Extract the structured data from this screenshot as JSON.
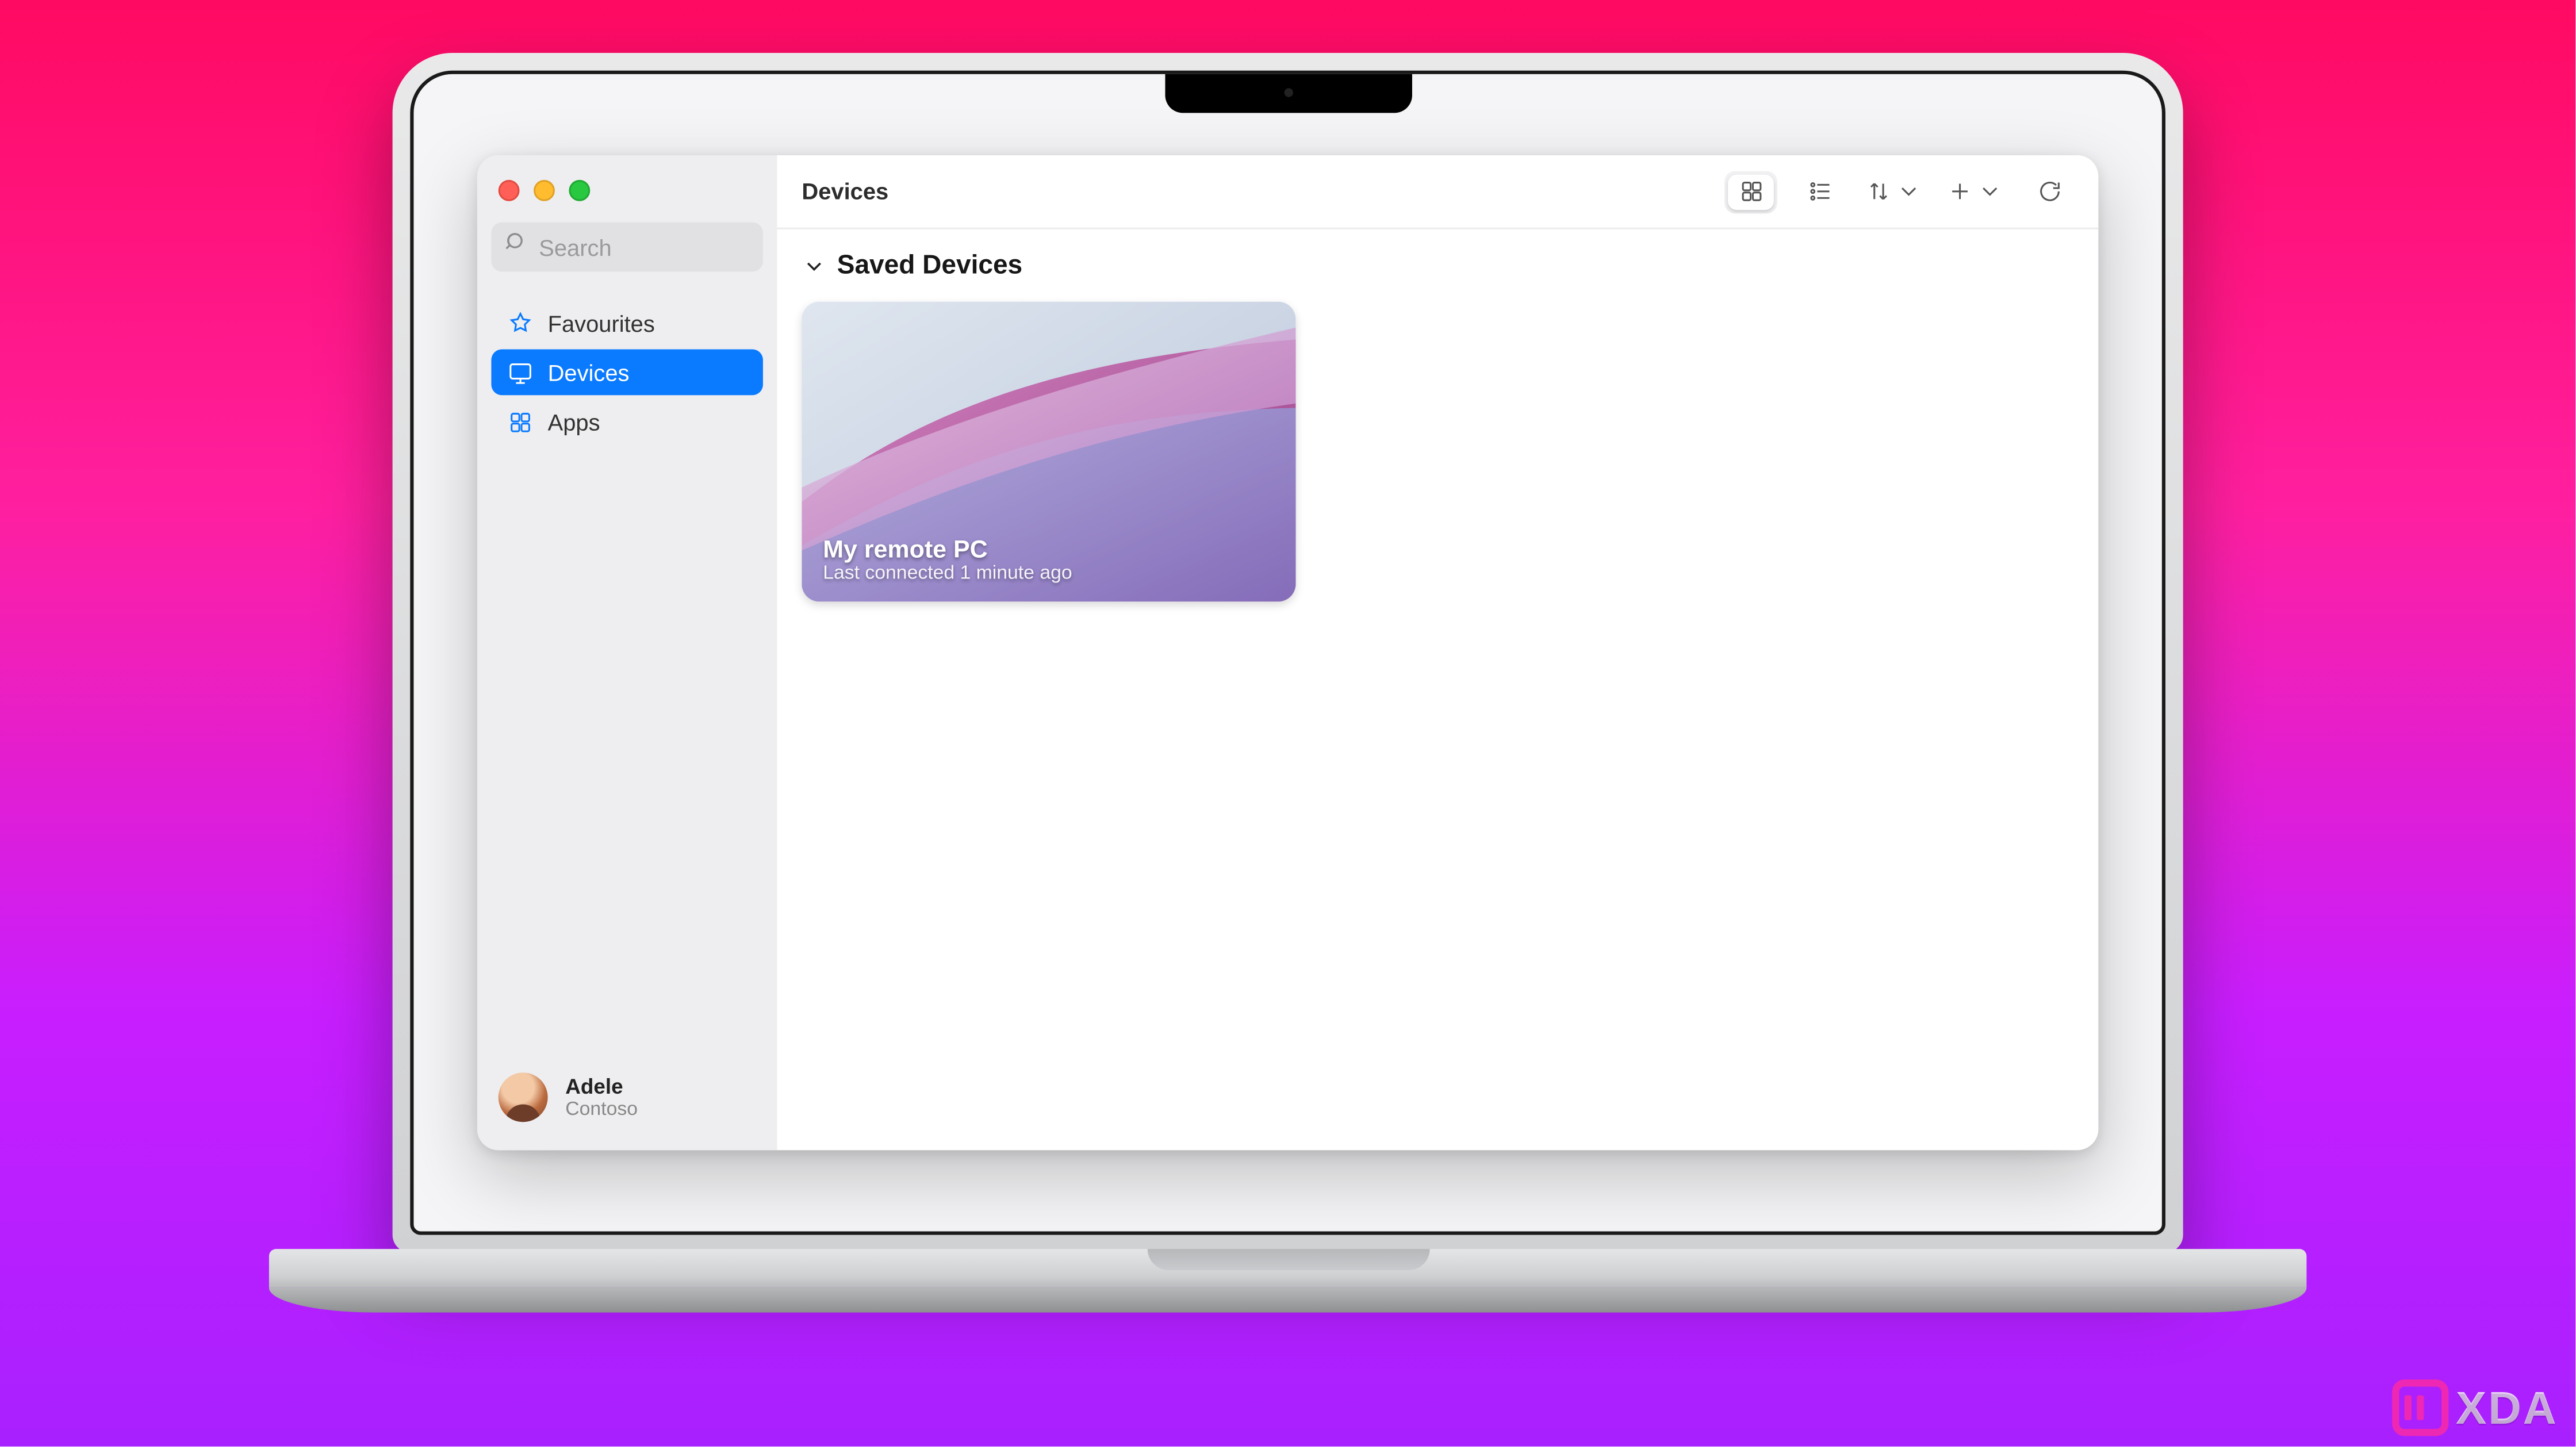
{
  "colors": {
    "accent": "#0a7aff"
  },
  "search": {
    "placeholder": "Search"
  },
  "sidebar": {
    "items": [
      {
        "label": "Favourites",
        "icon": "star-icon"
      },
      {
        "label": "Devices",
        "icon": "monitor-icon"
      },
      {
        "label": "Apps",
        "icon": "apps-grid-icon"
      }
    ],
    "activeIndex": 1
  },
  "user": {
    "name": "Adele",
    "org": "Contoso"
  },
  "header": {
    "title": "Devices"
  },
  "toolbar": {
    "view": {
      "grid": "grid-icon",
      "list": "list-icon",
      "active": "grid"
    },
    "sort_icon": "sort-icon",
    "add_icon": "plus-icon",
    "refresh_icon": "refresh-icon"
  },
  "section": {
    "title": "Saved Devices"
  },
  "devices": [
    {
      "name": "My remote PC",
      "subtitle": "Last connected 1 minute ago"
    }
  ],
  "watermark": {
    "text": "XDA"
  }
}
